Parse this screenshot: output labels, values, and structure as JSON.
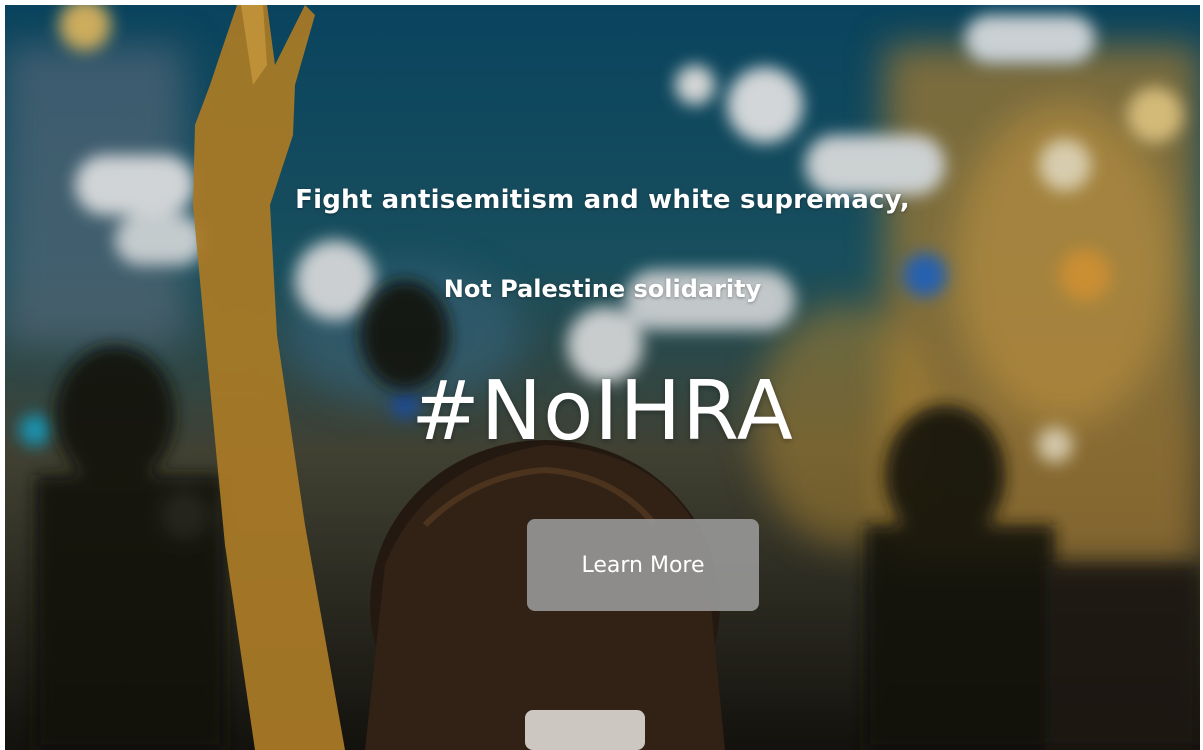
{
  "hero": {
    "headline_line1": "Fight antisemitism and white supremacy,",
    "headline_line2": "Not Palestine solidarity",
    "hashtag": "#NoIHRA",
    "cta_label": "Learn More",
    "background_image": "blurred-night-protest-photo"
  },
  "colors": {
    "text": "#ffffff",
    "button_bg": "#969696"
  }
}
